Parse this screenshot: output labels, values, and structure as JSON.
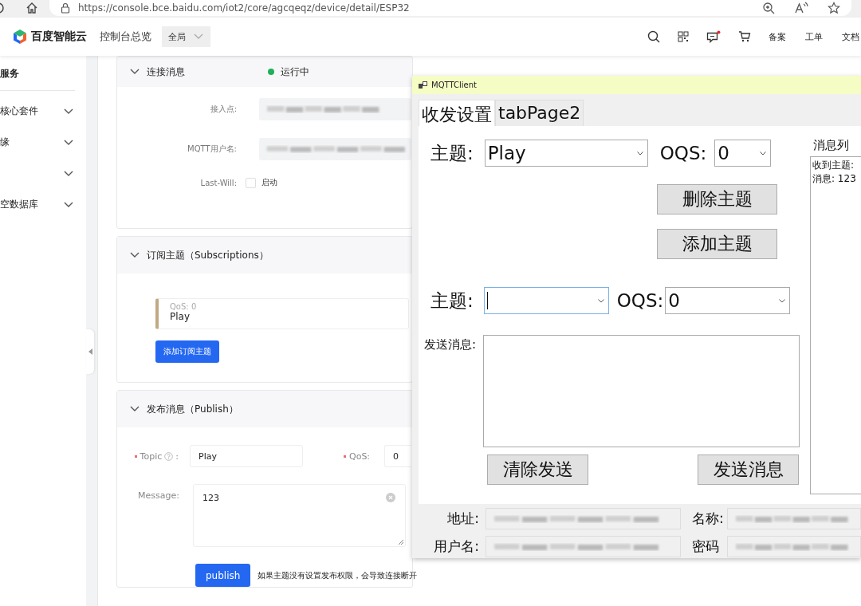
{
  "browser": {
    "url": "https://console.bce.baidu.com/iot2/core/agcqeqz/device/detail/ESP32"
  },
  "header": {
    "brand": "百度智能云",
    "nav": "控制台总览",
    "region": "全局",
    "notification_dot": true,
    "links": [
      "备案",
      "工单",
      "文档"
    ]
  },
  "sidebar": {
    "title": "服务",
    "items": [
      {
        "label": "核心套件",
        "expanded": false
      },
      {
        "label": "缘",
        "expanded": false
      },
      {
        "expanded": false
      },
      {
        "label": "空数据库",
        "expanded": false
      }
    ]
  },
  "connection": {
    "title": "连接消息",
    "status": "运行中",
    "fields": [
      {
        "kind": "redacted",
        "label": "接入点:"
      },
      {
        "kind": "redacted",
        "label": "MQTT用户名:"
      },
      {
        "kind": "checkbox",
        "label": "Last-Will:",
        "checked": false,
        "text": "启动"
      }
    ]
  },
  "subscriptions": {
    "title": "订阅主题（Subscriptions）",
    "items": [
      {
        "qos": "QoS: 0",
        "topic": "Play"
      }
    ],
    "add_button": "添加订阅主题"
  },
  "publish": {
    "title": "发布消息（Publish）",
    "topic_label": "Topic",
    "topic_suffix": ":",
    "topic": "Play",
    "qos_label": "QoS:",
    "qos": "0",
    "message_label": "Message:",
    "message": "123",
    "button": "publish",
    "note": "如果主题没有设置发布权限，会导致连接断开"
  },
  "mqtt_client": {
    "title": "MQTTClient",
    "tabs": [
      {
        "label": "收发设置",
        "selected": true
      },
      {
        "label": "tabPage2",
        "selected": false
      }
    ],
    "subscribe": {
      "topic_label": "主题:",
      "topic": "Play",
      "focused": false,
      "qos_label": "OQS:",
      "qos": "0",
      "buttons": [
        "删除主题",
        "添加主题"
      ]
    },
    "publish": {
      "topic_label": "主题:",
      "focused": true,
      "qos_label": "OQS:",
      "qos": "0",
      "message_label": "发送消息:",
      "buttons": [
        "清除发送",
        "发送消息"
      ]
    },
    "log": {
      "title": "消息列",
      "lines": [
        "收到主题:",
        "消息: 123"
      ]
    },
    "connection": [
      {
        "label": "地址:"
      },
      {
        "label": "名称:"
      },
      {
        "label": "用户名:"
      },
      {
        "label": "密码"
      }
    ]
  }
}
